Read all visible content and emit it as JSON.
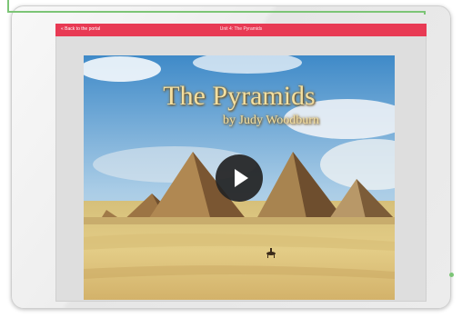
{
  "header": {
    "back_label": "« Back to the portal",
    "title": "Unit 4: The Pyramids"
  },
  "video": {
    "title": "The Pyramids",
    "subtitle": "by Judy Woodburn",
    "play_icon": "play-icon"
  },
  "colors": {
    "header_bar": "#e83a54",
    "accent_green": "#7cc576",
    "play_button": "#232323"
  }
}
